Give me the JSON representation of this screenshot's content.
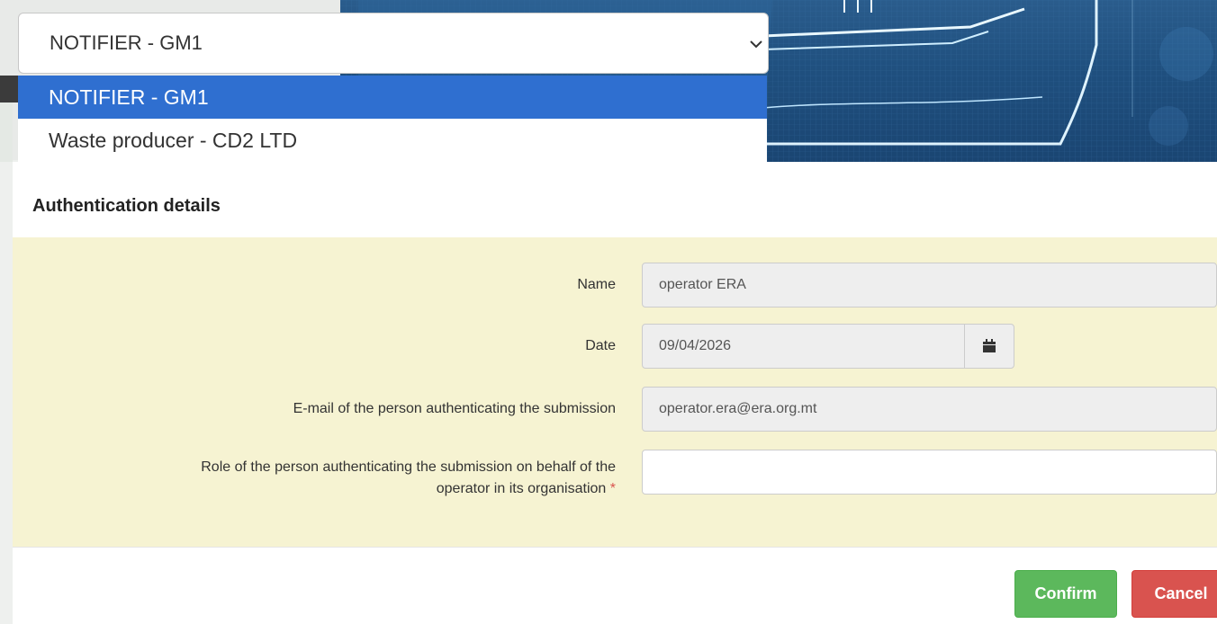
{
  "role_select": {
    "value": "NOTIFIER - GM1",
    "options": [
      {
        "label": "NOTIFIER - GM1",
        "selected": true
      },
      {
        "label": "Waste producer - CD2 LTD",
        "selected": false
      }
    ]
  },
  "panel": {
    "title": "Authentication details",
    "fields": {
      "name": {
        "label": "Name",
        "value": "operator ERA"
      },
      "date": {
        "label": "Date",
        "value": "09/04/2026"
      },
      "email": {
        "label": "E-mail of the person authenticating the submission",
        "value": "operator.era@era.org.mt"
      },
      "role": {
        "label_line1": "Role of the person authenticating the submission on behalf of the",
        "label_line2": "operator in its organisation",
        "required_mark": "*",
        "value": ""
      }
    },
    "buttons": {
      "confirm": "Confirm",
      "cancel": "Cancel"
    }
  },
  "colors": {
    "selected_option": "#2f6fd0",
    "form_background": "#f6f3d2",
    "confirm": "#5cb85c",
    "cancel": "#d9534f",
    "banner": "#1f4f7e"
  },
  "icons": {
    "select": "chevron-down-icon",
    "date": "calendar-icon"
  }
}
